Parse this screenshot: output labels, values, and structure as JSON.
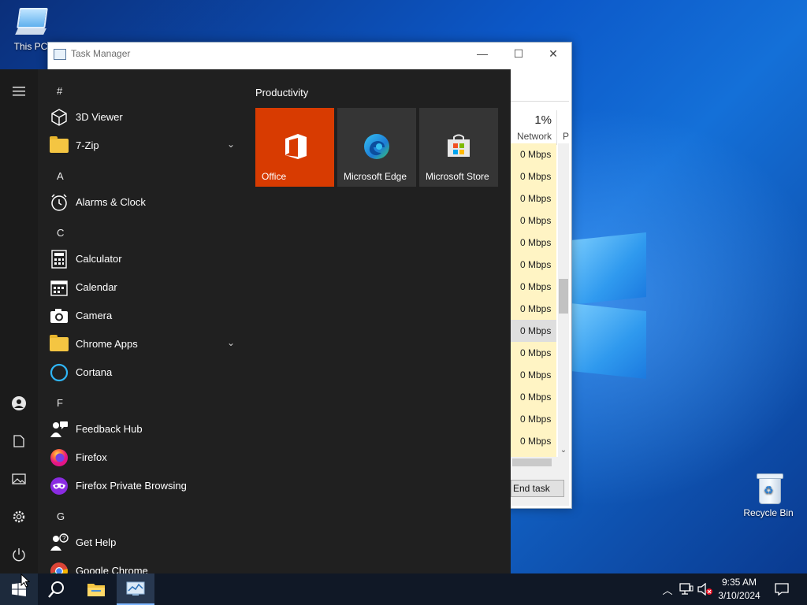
{
  "desktop": {
    "icons": [
      {
        "label": "This PC"
      },
      {
        "label": "Recycle Bin"
      }
    ]
  },
  "task_manager": {
    "title": "Task Manager",
    "column": {
      "percent": "1%",
      "label": "Network",
      "next_label": "P"
    },
    "rows": [
      "0 Mbps",
      "0 Mbps",
      "0 Mbps",
      "0 Mbps",
      "0 Mbps",
      "0 Mbps",
      "0 Mbps",
      "0 Mbps",
      "0 Mbps",
      "0 Mbps",
      "0 Mbps",
      "0 Mbps",
      "0 Mbps",
      "0 Mbps",
      "0 Mbps"
    ],
    "selected_row": 8,
    "end_task_label": "End task"
  },
  "start_menu": {
    "letters": [
      "#",
      "A",
      "C",
      "F",
      "G"
    ],
    "apps": [
      {
        "name": "3D Viewer"
      },
      {
        "name": "7-Zip",
        "expandable": true
      },
      {
        "name": "Alarms & Clock"
      },
      {
        "name": "Calculator"
      },
      {
        "name": "Calendar"
      },
      {
        "name": "Camera"
      },
      {
        "name": "Chrome Apps",
        "expandable": true
      },
      {
        "name": "Cortana"
      },
      {
        "name": "Feedback Hub"
      },
      {
        "name": "Firefox"
      },
      {
        "name": "Firefox Private Browsing"
      },
      {
        "name": "Get Help"
      },
      {
        "name": "Google Chrome"
      }
    ],
    "tile_group": "Productivity",
    "tiles": [
      {
        "label": "Office",
        "color": "#d83b01"
      },
      {
        "label": "Microsoft Edge"
      },
      {
        "label": "Microsoft Store"
      }
    ]
  },
  "taskbar": {
    "time": "9:35 AM",
    "date": "3/10/2024"
  },
  "colors": {
    "accent": "#0078d7",
    "start_bg": "#202020",
    "taskbar_bg": "#101826"
  }
}
